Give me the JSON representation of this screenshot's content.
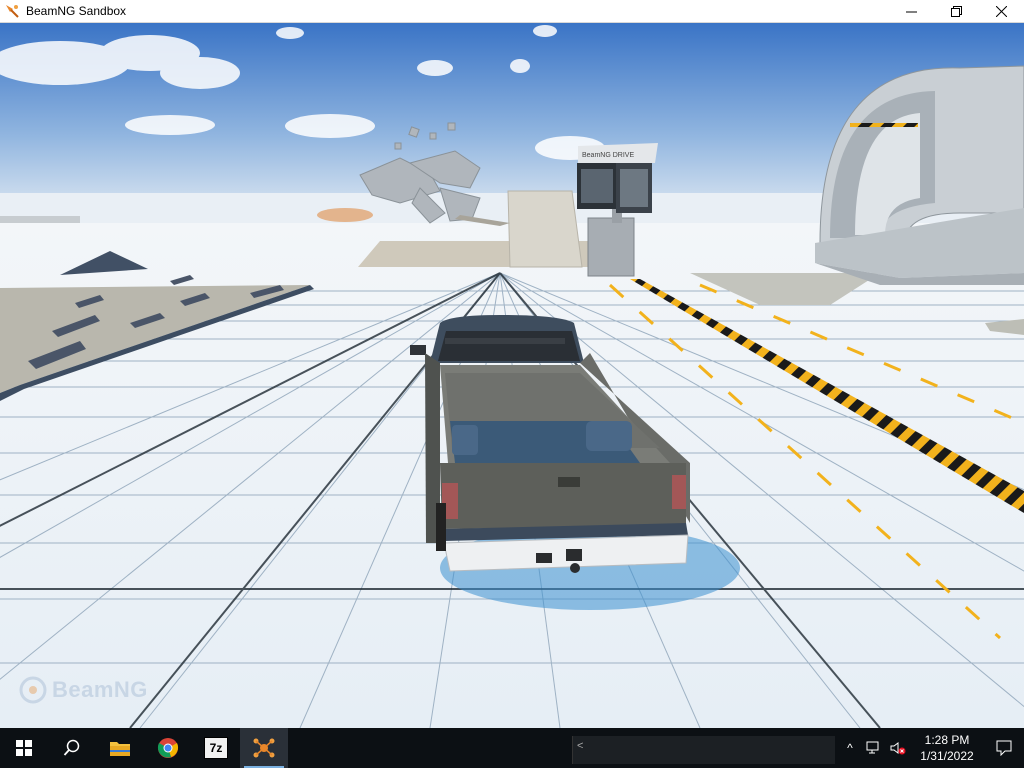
{
  "window": {
    "title": "BeamNG Sandbox",
    "minimize_icon": "minimize-icon",
    "maximize_icon": "restore-icon",
    "close_icon": "close-icon"
  },
  "game": {
    "watermark": "BeamNG",
    "billboard_text": "BeamNG DRIVE"
  },
  "taskbar": {
    "items": [
      {
        "name": "start-button",
        "icon": "windows-logo-icon"
      },
      {
        "name": "search-button",
        "icon": "search-icon"
      },
      {
        "name": "file-explorer",
        "icon": "folder-icon"
      },
      {
        "name": "chrome",
        "icon": "chrome-icon"
      },
      {
        "name": "7zip",
        "icon": "7zip-icon",
        "label": "7z"
      },
      {
        "name": "beamng",
        "icon": "beamng-icon",
        "active": true
      }
    ],
    "console_chevron": "<",
    "tray": {
      "chevron": "^",
      "time": "1:28 PM",
      "date": "1/31/2022"
    }
  },
  "colors": {
    "sky_top": "#3f78c9",
    "sky_bottom": "#dfe8f2",
    "ground": "#eef3f7",
    "truck_body": "#5d5f5a",
    "taskbar": "#0c1014",
    "hazard_yellow": "#f2b21c"
  }
}
